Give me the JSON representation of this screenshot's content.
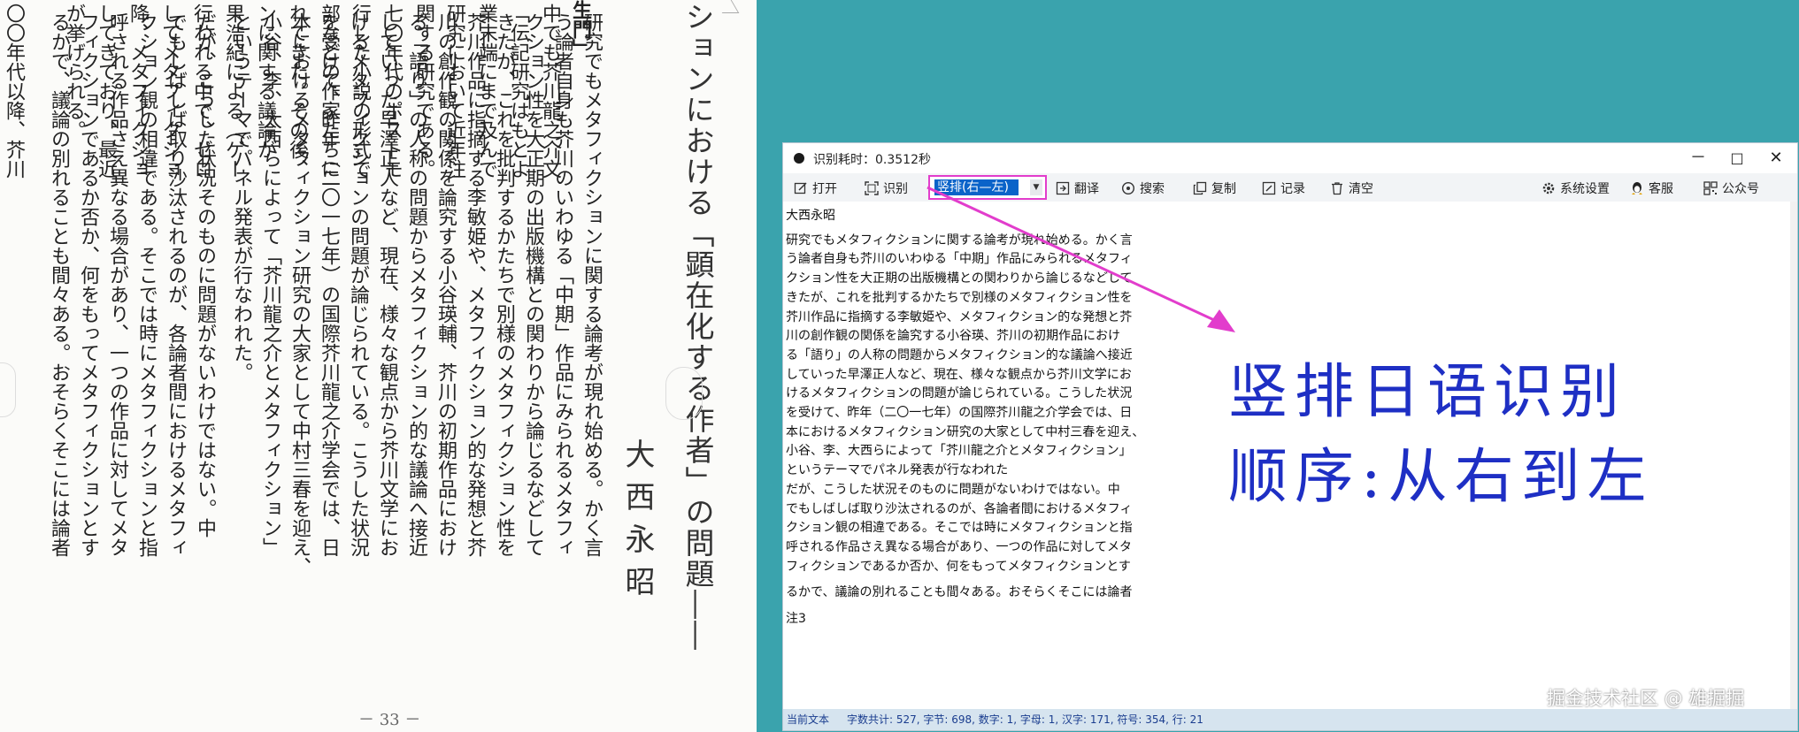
{
  "book": {
    "left_columns": [
      "生門」",
      "中でも芥川龍之介文",
      "「伝記研究はもとよ",
      "業末端にまで及んで",
      "研究において近年注",
      "関する研究である。",
      "七〇年代のポストモ",
      "行した小説の形式で",
      "部などの作家たちに",
      "れてきた。その後、",
      "ンに関する議論が",
      "果浩紀による（ゲー",
      "行われる中で、ゼロ",
      "してメタフィクショ",
      "降、メタフィクショ",
      "してきており、最近",
      "が挙げられる。",
      "〇〇年代以降、芥川"
    ],
    "heading": "ションにおける「顕在化する作者」の問題――",
    "author": "大西永昭",
    "right_columns": [
      "研究でもメタフィクションに関する論考が現れ始める。かく言",
      "う論者自身も芥川のいわゆる「中期」作品にみられるメタフィ",
      "クション性を大正期の出版機構との関わりから論じるなどして",
      "きたが、これを批判するかたちで別様のメタフィクション性を",
      "芥川作品に指摘する李敏姫や、メタフィクション的な発想と芥",
      "川の創作観の関係を論究する小谷瑛輔、芥川の初期作品におけ",
      "る「語り」の人称の問題からメタフィクション的な議論へ接近",
      "していった早澤正人など、現在、様々な観点から芥川文学にお",
      "けるメタフィクションの問題が論じられている。こうした状況",
      "を受けて、昨年（二〇一七年）の国際芥川龍之介学会では、日",
      "本におけるメタフィクション研究の大家として中村三春を迎え、",
      "小谷、李、大西らによって「芥川龍之介とメタフィクション」",
      "というテーマでパネル発表が行なわれた。",
      "だが、こうした状況そのものに問題がないわけではない。中",
      "でもしばしば取り沙汰されるのが、各論者間におけるメタフィ",
      "クション観の相違である。そこでは時にメタフィクションと指",
      "呼される作品さえ異なる場合があり、一つの作品に対してメタ",
      "フィクションであるか否か、何をもってメタフィクションとす",
      "るかで、議論の別れることも間々ある。おそらくそこには論者"
    ],
    "page_number": "－ 33 －"
  },
  "window": {
    "title": "识别耗时：0.3512秒",
    "minimize": "－",
    "maximize": "□",
    "close": "✕"
  },
  "toolbar": {
    "open": "打开",
    "recognize": "识别",
    "mode_selected": "竖排(右—左)",
    "translate": "翻译",
    "search": "搜索",
    "copy": "复制",
    "record": "记录",
    "clear": "清空",
    "settings": "系统设置",
    "service": "客服",
    "official_account": "公众号"
  },
  "result_lines": [
    "大西永昭",
    "研究でもメタフィクションに関する論考が現れ始める。かく言",
    "う論者自身も芥川のいわゆる「中期」作品にみられるメタフィ",
    "クション性を大正期の出版機構との関わりから論じるなどして",
    "きたが、これを批判するかたちで別様のメタフィクション性を",
    "芥川作品に指摘する李敏姫や、メタフィクション的な発想と芥",
    "川の創作観の関係を論究する小谷瑛、芥川の初期作品におけ",
    "る「語り」の人称の問題からメタフィクション的な議論へ接近",
    "していった早澤正人など、現在、様々な観点から芥川文学にお",
    "けるメタフィクションの問題が論じられている。こうした状況",
    "を受けて、昨年（二〇一七年）の国際芥川龍之介学会では、日",
    "本におけるメタフィクション研究の大家として中村三春を迎え、",
    "小谷、李、大西らによって「芥川龍之介とメタフィクション」",
    "というテーマでパネル発表が行なわれた",
    "だが、こうした状況そのものに問題がないわけではない。中",
    "でもしばしば取り沙汰されるのが、各論者間におけるメタフィ",
    "クション観の相違である。そこでは時にメタフィクションと指",
    "呼される作品さえ異なる場合があり、一つの作品に対してメタ",
    "フィクションであるか否か、何をもってメタフィクションとす",
    "",
    "るかで、議論の別れることも間々ある。おそらくそこには論者",
    "",
    "注3"
  ],
  "status": {
    "prefix": "当前文本",
    "stats": "字数共计: 527,  字节: 698,  数字: 1,  字母: 1,  汉字: 171,  符号: 354,  行: 21"
  },
  "annotation": {
    "line1": "竖排日语识别",
    "line2": "顺序:从右到左"
  },
  "watermark": "掘金技术社区 @ 雄掘掘",
  "colors": {
    "desktop": "#3aa3ad",
    "highlight_border": "#e23dcc",
    "selection": "#0a63c9",
    "annotation": "#1e2fc4",
    "arrow": "#e23dcc"
  },
  "icons": [
    "open-icon",
    "recognize-icon",
    "translate-icon",
    "search-icon",
    "copy-icon",
    "record-icon",
    "clear-icon",
    "settings-icon",
    "service-icon",
    "qr-icon"
  ]
}
